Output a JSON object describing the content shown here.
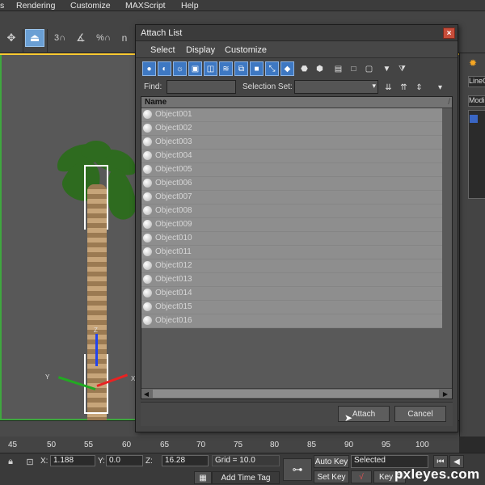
{
  "menu": {
    "items": [
      "s",
      "Rendering",
      "Customize",
      "MAXScript",
      "Help"
    ]
  },
  "toolbar": {
    "snap_label": "3",
    "percent_label": "%",
    "n_label": "n"
  },
  "dialog": {
    "title": "Attach List",
    "menu": [
      "Select",
      "Display",
      "Customize"
    ],
    "find_label": "Find:",
    "selection_set_label": "Selection Set:",
    "column_name": "Name",
    "rows": [
      "Object001",
      "Object002",
      "Object003",
      "Object004",
      "Object005",
      "Object006",
      "Object007",
      "Object008",
      "Object009",
      "Object010",
      "Object011",
      "Object012",
      "Object013",
      "Object014",
      "Object015",
      "Object016"
    ],
    "attach_label": "Attach",
    "cancel_label": "Cancel",
    "close_label": "×"
  },
  "right_panel": {
    "line_label": "LineO",
    "modifier_label": "Modi"
  },
  "timeline": {
    "ticks": [
      "45",
      "50",
      "55",
      "60",
      "65",
      "70",
      "75",
      "80",
      "85",
      "90",
      "95",
      "100"
    ]
  },
  "status": {
    "x_label": "X:",
    "x_value": "1.188",
    "y_label": "Y:",
    "y_value": "0.0",
    "z_label": "Z:",
    "z_value": "16.28",
    "grid": "Grid = 10.0",
    "auto_key": "Auto Key",
    "selected": "Selected",
    "set_key": "Set Key",
    "key_filters": "Key F",
    "add_time_tag": "Add Time Tag"
  },
  "viewport": {
    "axis_x_label": "X",
    "axis_y_label": "Y",
    "axis_z_label": "Z"
  },
  "watermark": "pxleyes.com",
  "colors": {
    "accent": "#3e78c2",
    "viewport_bg": "#585858",
    "active_border": "#3fa83f"
  }
}
